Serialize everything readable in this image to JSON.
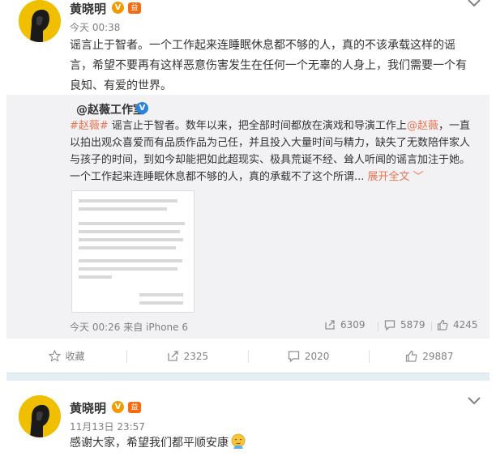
{
  "post1": {
    "author": "黄晓明",
    "time": "今天 00:38",
    "verified_badge": "V",
    "vip_badge": "益",
    "text_lines": [
      "谣言止于智者。一个工作起来连睡眠休息都不够的人，真的不该承载这样的谣",
      "言，希望不要再有这样恶意伤害发生在任何一个无辜的人身上，我们需要一个有",
      "良知、有爱的世界。"
    ],
    "repost": {
      "author": "@赵薇工作室",
      "verified_badge": "V",
      "text_segments": [
        {
          "t": "#赵薇#",
          "hl": true
        },
        {
          "t": " 谣言止于智者。数年以来，把全部时间都放在演戏和导演工作上",
          "hl": false
        },
        {
          "t": "@赵薇",
          "hl": true
        },
        {
          "t": "，一直以拍出观众喜爱而有品质作品为己任，并且投入大量时间与精力，缺失了无数陪伴家人与孩子的时间，到如今却能把如此超现实、极具荒诞不经、耸人听闻的谣言加注于她。一个工作起来连睡眠休息都不够的人，真的承载不了这个所谓... ",
          "hl": false
        },
        {
          "t": "展开全文 ﹀",
          "hl": true
        }
      ],
      "time": "今天 00:26 来自 iPhone 6",
      "stats": {
        "forward": "6309",
        "comment": "5879",
        "like": "4245"
      }
    },
    "actions": {
      "favorite": "收藏",
      "forward": "2325",
      "comment": "2020",
      "like": "29887"
    }
  },
  "post2": {
    "author": "黄晓明",
    "time": "11月13日 23:57",
    "verified_badge": "V",
    "vip_badge": "益",
    "text": "感谢大家，希望我们都平顺安康"
  },
  "colors": {
    "accent": "#eb7350",
    "meta_gray": "#808080",
    "repost_bg": "#f2f2f5",
    "avatar_bg": "#f0c000"
  }
}
